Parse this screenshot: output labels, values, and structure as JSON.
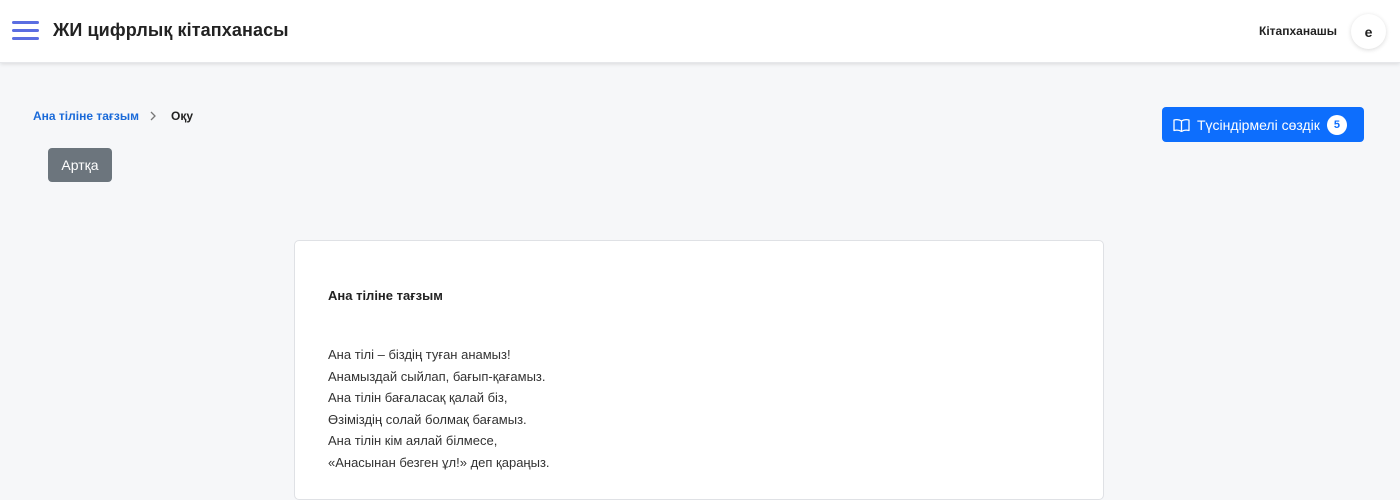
{
  "header": {
    "app_title": "ЖИ цифрлық кітапханасы",
    "user_role": "Кітапханашы",
    "avatar_initial": "e"
  },
  "breadcrumb": {
    "link": "Ана тіліне тағзым",
    "current": "Оқу"
  },
  "back_button": {
    "label": "Артқа"
  },
  "glossary_button": {
    "label": "Түсіндірмелі сөздік",
    "count": "5"
  },
  "card": {
    "title": "Ана тіліне тағзым",
    "lines": [
      "Ана тілі – біздің туған анамыз!",
      "Анамыздай сыйлап, бағып-қағамыз.",
      "Ана тілін бағаласақ қалай біз,",
      "Өзіміздің солай болмақ бағамыз.",
      "Ана тілін кім аялай білмесе,",
      "«Анасынан безген ұл!» деп қараңыз."
    ]
  },
  "colors": {
    "accent": "#0d6efd",
    "menu_icon": "#5b6ee1",
    "back_button": "#6c757d",
    "link": "#1a6ad9"
  }
}
